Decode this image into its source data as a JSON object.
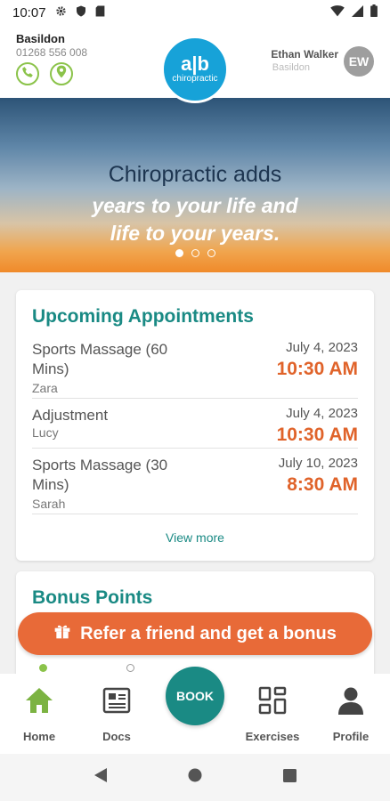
{
  "status": {
    "time": "10:07"
  },
  "header": {
    "clinic_name": "Basildon",
    "clinic_phone": "01268 556 008",
    "logo_mark": "a|b",
    "logo_text": "chiropractic",
    "user_name": "Ethan Walker",
    "user_location": "Basildon",
    "avatar_initials": "EW"
  },
  "banner": {
    "line1": "Chiropractic adds",
    "line2": "years to your life and",
    "line3": "life to your years.",
    "dots": 3,
    "active_dot": 0
  },
  "appointments": {
    "title": "Upcoming Appointments",
    "items": [
      {
        "service": "Sports Massage (60 Mins)",
        "staff": "Zara",
        "date": "July 4, 2023",
        "time": "10:30 AM"
      },
      {
        "service": "Adjustment",
        "staff": "Lucy",
        "date": "July 4, 2023",
        "time": "10:30 AM"
      },
      {
        "service": "Sports Massage (30 Mins)",
        "staff": "Sarah",
        "date": "July 10, 2023",
        "time": "8:30 AM"
      }
    ],
    "view_more": "View more"
  },
  "bonus": {
    "title": "Bonus Points",
    "refer_label": "Refer a friend and get a bonus"
  },
  "nav": {
    "home": "Home",
    "docs": "Docs",
    "book": "BOOK",
    "exercises": "Exercises",
    "profile": "Profile"
  },
  "colors": {
    "teal": "#1a8a84",
    "orange": "#e0632a",
    "green": "#8bc34a",
    "logo_blue": "#17a2d8"
  }
}
